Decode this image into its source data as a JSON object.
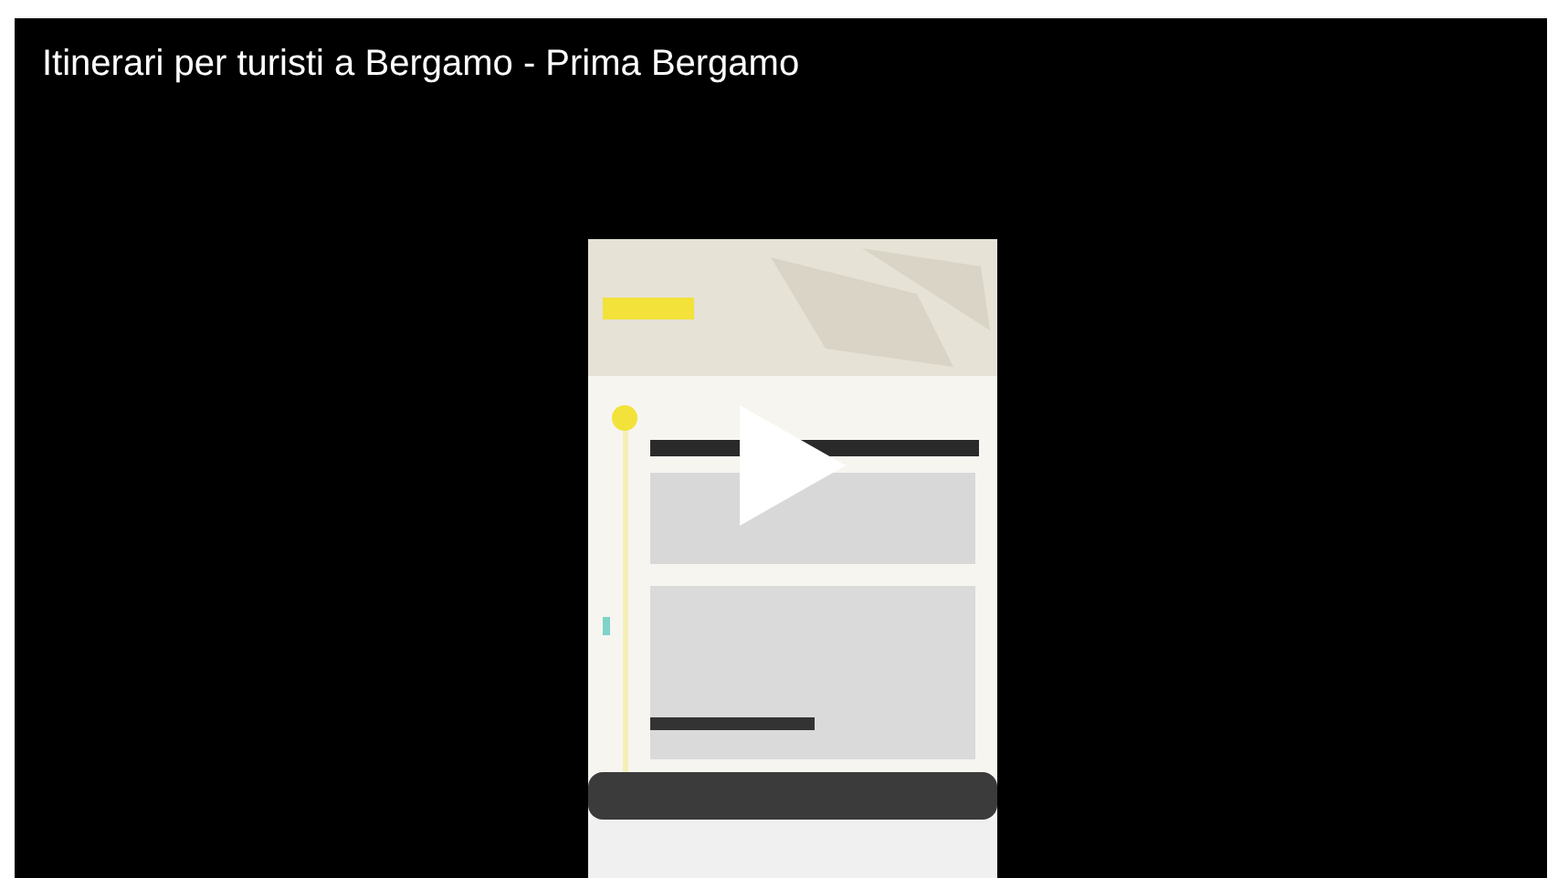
{
  "video": {
    "title": "Itinerari per turisti a Bergamo - Prima Bergamo"
  }
}
